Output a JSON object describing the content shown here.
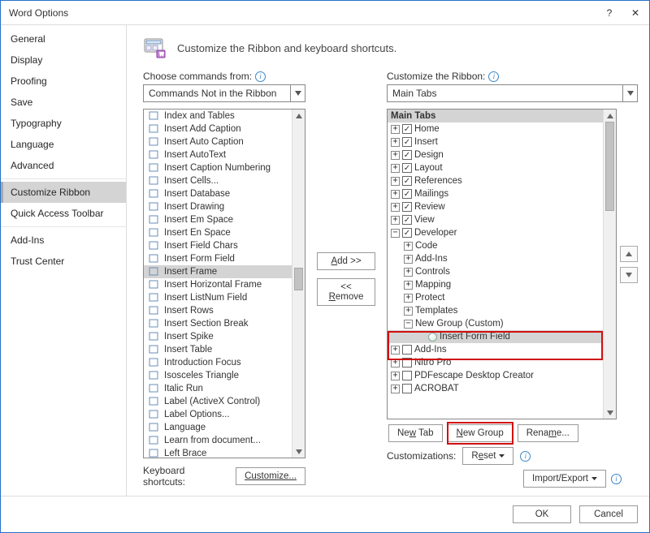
{
  "window": {
    "title": "Word Options",
    "help": "?",
    "close": "✕"
  },
  "sidebar": {
    "items": [
      {
        "label": "General"
      },
      {
        "label": "Display"
      },
      {
        "label": "Proofing"
      },
      {
        "label": "Save"
      },
      {
        "label": "Typography"
      },
      {
        "label": "Language"
      },
      {
        "label": "Advanced"
      },
      {
        "label": "Customize Ribbon",
        "selected": true
      },
      {
        "label": "Quick Access Toolbar"
      },
      {
        "label": "Add-Ins"
      },
      {
        "label": "Trust Center"
      }
    ]
  },
  "header": {
    "text": "Customize the Ribbon and keyboard shortcuts."
  },
  "left_panel": {
    "label": "Choose commands from:",
    "select_value": "Commands Not in the Ribbon",
    "commands": [
      "Index and Tables",
      "Insert Add Caption",
      "Insert Auto Caption",
      "Insert AutoText",
      "Insert Caption Numbering",
      "Insert Cells...",
      "Insert Database",
      "Insert Drawing",
      "Insert Em Space",
      "Insert En Space",
      "Insert Field Chars",
      "Insert Form Field",
      "Insert Frame",
      "Insert Horizontal Frame",
      "Insert ListNum Field",
      "Insert Rows",
      "Insert Section Break",
      "Insert Spike",
      "Insert Table",
      "Introduction Focus",
      "Isosceles Triangle",
      "Italic Run",
      "Label (ActiveX Control)",
      "Label Options...",
      "Language",
      "Learn from document...",
      "Left Brace"
    ],
    "selected_index": 12
  },
  "mid_buttons": {
    "add": "Add >>",
    "remove": "<< Remove"
  },
  "right_panel": {
    "label": "Customize the Ribbon:",
    "select_value": "Main Tabs",
    "tree_header": "Main Tabs",
    "tabs": [
      {
        "expand": "+",
        "checked": true,
        "label": "Home"
      },
      {
        "expand": "+",
        "checked": true,
        "label": "Insert"
      },
      {
        "expand": "+",
        "checked": true,
        "label": "Design"
      },
      {
        "expand": "+",
        "checked": true,
        "label": "Layout"
      },
      {
        "expand": "+",
        "checked": true,
        "label": "References"
      },
      {
        "expand": "+",
        "checked": true,
        "label": "Mailings"
      },
      {
        "expand": "+",
        "checked": true,
        "label": "Review"
      },
      {
        "expand": "+",
        "checked": true,
        "label": "View"
      },
      {
        "expand": "−",
        "checked": true,
        "label": "Developer",
        "children": [
          {
            "expand": "+",
            "label": "Code"
          },
          {
            "expand": "+",
            "label": "Add-Ins"
          },
          {
            "expand": "+",
            "label": "Controls"
          },
          {
            "expand": "+",
            "label": "Mapping"
          },
          {
            "expand": "+",
            "label": "Protect"
          },
          {
            "expand": "+",
            "label": "Templates"
          },
          {
            "expand": "−",
            "label": "New Group (Custom)",
            "custom": true,
            "children": [
              {
                "label": "Insert Form Field",
                "icon": "circle",
                "selected": true
              }
            ]
          }
        ]
      },
      {
        "expand": "+",
        "checked": false,
        "label": "Add-Ins"
      },
      {
        "expand": "+",
        "checked": false,
        "label": "Nitro Pro"
      },
      {
        "expand": "+",
        "checked": false,
        "label": "PDFescape Desktop Creator"
      },
      {
        "expand": "+",
        "checked": false,
        "label": "ACROBAT"
      }
    ],
    "buttons": {
      "new_tab": "New Tab",
      "new_group": "New Group",
      "rename": "Rename..."
    },
    "customizations_label": "Customizations:",
    "reset": "Reset",
    "import_export": "Import/Export"
  },
  "keyboard": {
    "label": "Keyboard shortcuts:",
    "button": "Customize..."
  },
  "footer": {
    "ok": "OK",
    "cancel": "Cancel"
  }
}
